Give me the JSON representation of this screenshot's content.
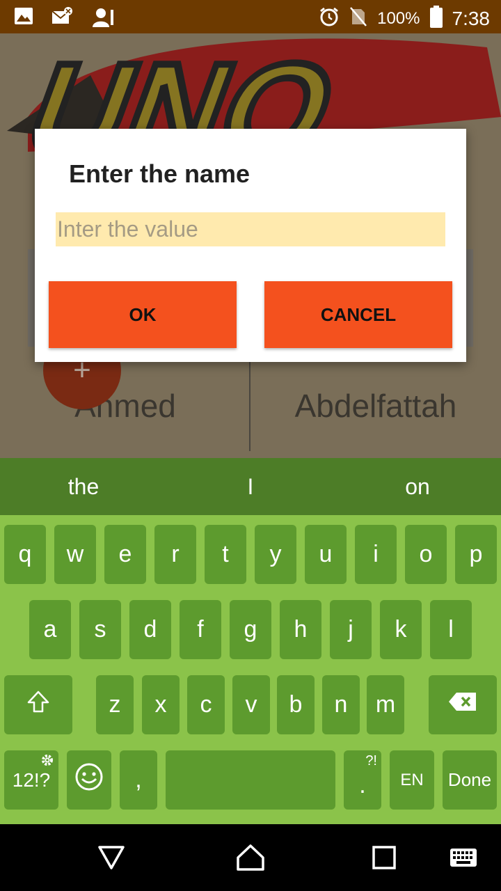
{
  "status_bar": {
    "battery": "100%",
    "time": "7:38",
    "icons": [
      "image-icon",
      "mail-icon",
      "account-icon",
      "alarm-icon",
      "no-sim-icon",
      "battery-icon"
    ]
  },
  "app": {
    "players": [
      "Ahmed",
      "Abdelfattah"
    ],
    "fab_symbol": "+",
    "logo_text": "UNO"
  },
  "dialog": {
    "title": "Enter the name",
    "input_value": "",
    "input_placeholder": "Inter the value",
    "ok_label": "OK",
    "cancel_label": "CANCEL"
  },
  "keyboard": {
    "suggestions": [
      "the",
      "I",
      "on"
    ],
    "row1": [
      "q",
      "w",
      "e",
      "r",
      "t",
      "y",
      "u",
      "i",
      "o",
      "p"
    ],
    "row2": [
      "a",
      "s",
      "d",
      "f",
      "g",
      "h",
      "j",
      "k",
      "l"
    ],
    "row3": [
      "z",
      "x",
      "c",
      "v",
      "b",
      "n",
      "m"
    ],
    "symbols_label": "12!?",
    "comma": ",",
    "period": ".",
    "period_alt": "?!",
    "lang_label": "EN",
    "done_label": "Done"
  },
  "colors": {
    "status_bar": "#6d3a00",
    "accent": "#f4511e",
    "keyboard_bg": "#8bc34a",
    "key_bg": "#5d9b2e",
    "suggestion_bg": "#4d7d27",
    "input_bg": "#ffeaae"
  }
}
